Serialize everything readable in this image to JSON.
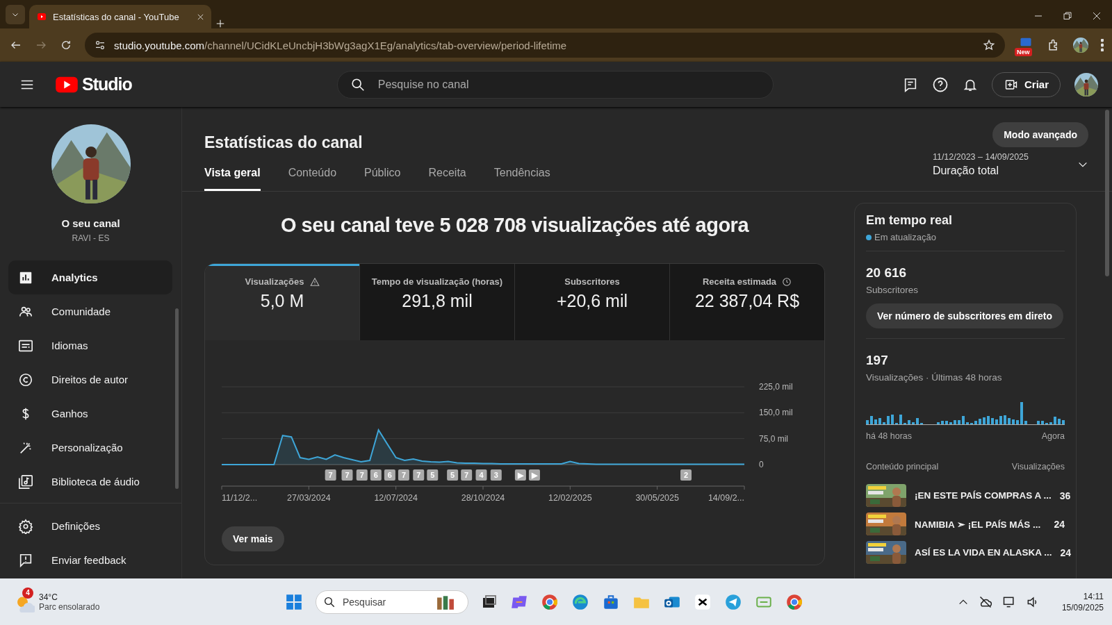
{
  "browser": {
    "tab_title": "Estatísticas do canal - YouTube",
    "url_host": "studio.youtube.com",
    "url_path": "/channel/UCidKLeUncbjH3bWg3agX1Eg/analytics/tab-overview/period-lifetime",
    "extension_badge": "New"
  },
  "header": {
    "logo_text": "Studio",
    "search_placeholder": "Pesquise no canal",
    "create_label": "Criar"
  },
  "sidebar": {
    "channel_name": "O seu canal",
    "channel_handle": "RAVI - ES",
    "items": [
      {
        "label": "Analytics",
        "selected": true
      },
      {
        "label": "Comunidade",
        "selected": false
      },
      {
        "label": "Idiomas",
        "selected": false
      },
      {
        "label": "Direitos de autor",
        "selected": false
      },
      {
        "label": "Ganhos",
        "selected": false
      },
      {
        "label": "Personalização",
        "selected": false
      },
      {
        "label": "Biblioteca de áudio",
        "selected": false
      }
    ],
    "footer_items": [
      {
        "label": "Definições"
      },
      {
        "label": "Enviar feedback"
      }
    ]
  },
  "main": {
    "title": "Estatísticas do canal",
    "mode_button": "Modo avançado",
    "date_range": "11/12/2023 – 14/09/2025",
    "period": "Duração total",
    "tabs": [
      {
        "label": "Vista geral",
        "selected": true
      },
      {
        "label": "Conteúdo",
        "selected": false
      },
      {
        "label": "Público",
        "selected": false
      },
      {
        "label": "Receita",
        "selected": false
      },
      {
        "label": "Tendências",
        "selected": false
      }
    ],
    "headline": "O seu canal teve 5 028 708 visualizações até agora",
    "metrics": [
      {
        "label": "Visualizações",
        "value": "5,0 M",
        "selected": true
      },
      {
        "label": "Tempo de visualização (horas)",
        "value": "291,8 mil",
        "selected": false
      },
      {
        "label": "Subscritores",
        "value": "+20,6 mil",
        "selected": false
      },
      {
        "label": "Receita estimada",
        "value": "22 387,04 R$",
        "selected": false
      }
    ],
    "chart_data": {
      "type": "area",
      "categories": [
        "11/12/2...",
        null,
        null,
        null,
        null,
        null,
        null,
        null,
        null,
        null,
        "27/03/2024",
        null,
        null,
        null,
        null,
        null,
        null,
        null,
        null,
        null,
        "12/07/2024",
        null,
        null,
        null,
        null,
        null,
        null,
        null,
        null,
        null,
        "28/10/2024",
        null,
        null,
        null,
        null,
        null,
        null,
        null,
        null,
        null,
        "12/02/2025",
        null,
        null,
        null,
        null,
        null,
        null,
        null,
        null,
        null,
        "30/05/2025",
        null,
        null,
        null,
        null,
        null,
        null,
        null,
        null,
        null,
        "14/09/2..."
      ],
      "series": [
        {
          "color": "#3ea6d8",
          "values": [
            0,
            0,
            0,
            0,
            0,
            0,
            0,
            84,
            80,
            20,
            15,
            22,
            15,
            28,
            20,
            14,
            8,
            12,
            100,
            60,
            20,
            12,
            16,
            10,
            8,
            7,
            9,
            5,
            4,
            4,
            3,
            3,
            2,
            2,
            2,
            2,
            2,
            2,
            2,
            2,
            9,
            3,
            2,
            1,
            1,
            1,
            1,
            1,
            1,
            1,
            1,
            1,
            1,
            1,
            1,
            1,
            1,
            1,
            1,
            1,
            1
          ]
        }
      ],
      "ylim": [
        0,
        225
      ],
      "yticks": [
        {
          "value": 0,
          "label": "0"
        },
        {
          "value": 75,
          "label": "75,0 mil"
        },
        {
          "value": 150,
          "label": "150,0 mil"
        },
        {
          "value": 225,
          "label": "225,0 mil"
        }
      ],
      "annotations": [
        "7",
        "7",
        "7",
        "6",
        "6",
        "7",
        "7",
        "5",
        "5",
        "7",
        "4",
        "3",
        "▶",
        "▶",
        "2"
      ]
    },
    "more_button": "Ver mais"
  },
  "realtime": {
    "title": "Em tempo real",
    "status": "Em atualização",
    "subscribers_count": "20 616",
    "subscribers_label": "Subscritores",
    "live_button": "Ver número de subscritores em direto",
    "views_count": "197",
    "views_label": "Visualizações · Últimas 48 horas",
    "start_label": "há 48 horas",
    "end_label": "Agora",
    "content_header": "Conteúdo principal",
    "views_header": "Visualizações",
    "top_content": [
      {
        "title": "¡EN ESTE PAÍS COMPRAS A ...",
        "views": "36",
        "kind": "picture"
      },
      {
        "title": "NAMIBIA ➣ ¡EL PAÍS MÁS ...",
        "views": "24",
        "kind": "picture"
      },
      {
        "title": "ASÍ ES LA VIDA EN ALASKA ...",
        "views": "24",
        "kind": "picture"
      }
    ]
  },
  "taskbar": {
    "weather_badge": "4",
    "temperature": "34°C",
    "weather": "Parc ensolarado",
    "search_placeholder": "Pesquisar",
    "time": "14:11",
    "date": "15/09/2025"
  }
}
